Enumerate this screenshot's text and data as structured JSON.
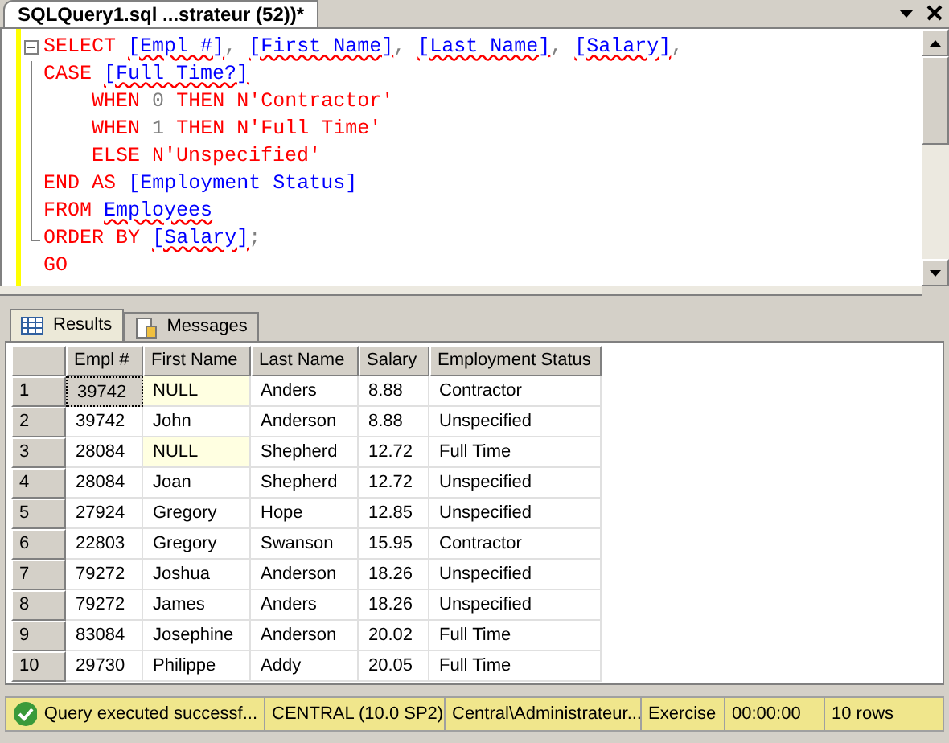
{
  "document_tab": {
    "title": "SQLQuery1.sql ...strateur (52))*"
  },
  "editor": {
    "lines": [
      {
        "kind": "open",
        "tokens": [
          {
            "text": "SELECT",
            "kind": "keyword"
          },
          {
            "text": "[Empl #]",
            "kind": "column"
          },
          {
            "text": ",",
            "kind": "punct"
          },
          {
            "text": "[First Name]",
            "kind": "column"
          },
          {
            "text": ",",
            "kind": "punct"
          },
          {
            "text": "[Last Name]",
            "kind": "column"
          },
          {
            "text": ",",
            "kind": "punct"
          },
          {
            "text": "[Salary]",
            "kind": "column"
          },
          {
            "text": ",",
            "kind": "punct"
          }
        ]
      },
      {
        "kind": "line",
        "tokens": [
          {
            "text": "CASE",
            "kind": "keyword"
          },
          {
            "text": "[Full Time?]",
            "kind": "column"
          }
        ]
      },
      {
        "kind": "line",
        "tokens": [
          {
            "text": "    WHEN",
            "kind": "keyword"
          },
          {
            "text": "0",
            "kind": "number"
          },
          {
            "text": "THEN",
            "kind": "keyword"
          },
          {
            "text": "N'Contractor'",
            "kind": "keyword"
          }
        ]
      },
      {
        "kind": "line",
        "tokens": [
          {
            "text": "    WHEN",
            "kind": "keyword"
          },
          {
            "text": "1",
            "kind": "number"
          },
          {
            "text": "THEN",
            "kind": "keyword"
          },
          {
            "text": "N'Full Time'",
            "kind": "keyword"
          }
        ]
      },
      {
        "kind": "line",
        "tokens": [
          {
            "text": "    ELSE",
            "kind": "keyword"
          },
          {
            "text": "N'Unspecified'",
            "kind": "keyword"
          }
        ]
      },
      {
        "kind": "line",
        "tokens": [
          {
            "text": "END",
            "kind": "keyword"
          },
          {
            "text": "AS",
            "kind": "keyword"
          },
          {
            "text": "[Employment Status]",
            "kind": "name"
          }
        ]
      },
      {
        "kind": "line",
        "tokens": [
          {
            "text": "FROM",
            "kind": "keyword"
          },
          {
            "text": "Employees",
            "kind": "column"
          }
        ]
      },
      {
        "kind": "end",
        "tokens": [
          {
            "text": "ORDER",
            "kind": "keyword"
          },
          {
            "text": "BY",
            "kind": "keyword"
          },
          {
            "text": "[Salary]",
            "kind": "column"
          },
          {
            "text": ";",
            "kind": "punct"
          }
        ]
      },
      {
        "kind": "none",
        "tokens": [
          {
            "text": "GO",
            "kind": "keyword"
          }
        ]
      }
    ]
  },
  "result_tabs": [
    {
      "label": "Results",
      "selected": true
    },
    {
      "label": "Messages",
      "selected": false
    }
  ],
  "table": {
    "columns": [
      "Empl #",
      "First Name",
      "Last Name",
      "Salary",
      "Employment Status"
    ],
    "rows": [
      {
        "number": "1",
        "cells": [
          {
            "text": "39742",
            "null": false,
            "focused": true
          },
          {
            "text": "NULL",
            "null": true,
            "focused": false
          },
          {
            "text": "Anders",
            "null": false,
            "focused": false
          },
          {
            "text": "8.88",
            "null": false,
            "focused": false
          },
          {
            "text": "Contractor",
            "null": false,
            "focused": false
          }
        ]
      },
      {
        "number": "2",
        "cells": [
          {
            "text": "39742",
            "null": false,
            "focused": false
          },
          {
            "text": "John",
            "null": false,
            "focused": false
          },
          {
            "text": "Anderson",
            "null": false,
            "focused": false
          },
          {
            "text": "8.88",
            "null": false,
            "focused": false
          },
          {
            "text": "Unspecified",
            "null": false,
            "focused": false
          }
        ]
      },
      {
        "number": "3",
        "cells": [
          {
            "text": "28084",
            "null": false,
            "focused": false
          },
          {
            "text": "NULL",
            "null": true,
            "focused": false
          },
          {
            "text": "Shepherd",
            "null": false,
            "focused": false
          },
          {
            "text": "12.72",
            "null": false,
            "focused": false
          },
          {
            "text": "Full Time",
            "null": false,
            "focused": false
          }
        ]
      },
      {
        "number": "4",
        "cells": [
          {
            "text": "28084",
            "null": false,
            "focused": false
          },
          {
            "text": "Joan",
            "null": false,
            "focused": false
          },
          {
            "text": "Shepherd",
            "null": false,
            "focused": false
          },
          {
            "text": "12.72",
            "null": false,
            "focused": false
          },
          {
            "text": "Unspecified",
            "null": false,
            "focused": false
          }
        ]
      },
      {
        "number": "5",
        "cells": [
          {
            "text": "27924",
            "null": false,
            "focused": false
          },
          {
            "text": "Gregory",
            "null": false,
            "focused": false
          },
          {
            "text": "Hope",
            "null": false,
            "focused": false
          },
          {
            "text": "12.85",
            "null": false,
            "focused": false
          },
          {
            "text": "Unspecified",
            "null": false,
            "focused": false
          }
        ]
      },
      {
        "number": "6",
        "cells": [
          {
            "text": "22803",
            "null": false,
            "focused": false
          },
          {
            "text": "Gregory",
            "null": false,
            "focused": false
          },
          {
            "text": "Swanson",
            "null": false,
            "focused": false
          },
          {
            "text": "15.95",
            "null": false,
            "focused": false
          },
          {
            "text": "Contractor",
            "null": false,
            "focused": false
          }
        ]
      },
      {
        "number": "7",
        "cells": [
          {
            "text": "79272",
            "null": false,
            "focused": false
          },
          {
            "text": "Joshua",
            "null": false,
            "focused": false
          },
          {
            "text": "Anderson",
            "null": false,
            "focused": false
          },
          {
            "text": "18.26",
            "null": false,
            "focused": false
          },
          {
            "text": "Unspecified",
            "null": false,
            "focused": false
          }
        ]
      },
      {
        "number": "8",
        "cells": [
          {
            "text": "79272",
            "null": false,
            "focused": false
          },
          {
            "text": "James",
            "null": false,
            "focused": false
          },
          {
            "text": "Anders",
            "null": false,
            "focused": false
          },
          {
            "text": "18.26",
            "null": false,
            "focused": false
          },
          {
            "text": "Unspecified",
            "null": false,
            "focused": false
          }
        ]
      },
      {
        "number": "9",
        "cells": [
          {
            "text": "83084",
            "null": false,
            "focused": false
          },
          {
            "text": "Josephine",
            "null": false,
            "focused": false
          },
          {
            "text": "Anderson",
            "null": false,
            "focused": false
          },
          {
            "text": "20.02",
            "null": false,
            "focused": false
          },
          {
            "text": "Full Time",
            "null": false,
            "focused": false
          }
        ]
      },
      {
        "number": "10",
        "cells": [
          {
            "text": "29730",
            "null": false,
            "focused": false
          },
          {
            "text": "Philippe",
            "null": false,
            "focused": false
          },
          {
            "text": "Addy",
            "null": false,
            "focused": false
          },
          {
            "text": "20.05",
            "null": false,
            "focused": false
          },
          {
            "text": "Full Time",
            "null": false,
            "focused": false
          }
        ]
      }
    ]
  },
  "status_bar": [
    {
      "text": "Query executed successf...",
      "kind": "success"
    },
    {
      "text": "CENTRAL (10.0 SP2)",
      "kind": "plain"
    },
    {
      "text": "Central\\Administrateur...",
      "kind": "plain"
    },
    {
      "text": "Exercise",
      "kind": "plain"
    },
    {
      "text": "00:00:00",
      "kind": "plain"
    },
    {
      "text": "10 rows",
      "kind": "plain"
    }
  ]
}
